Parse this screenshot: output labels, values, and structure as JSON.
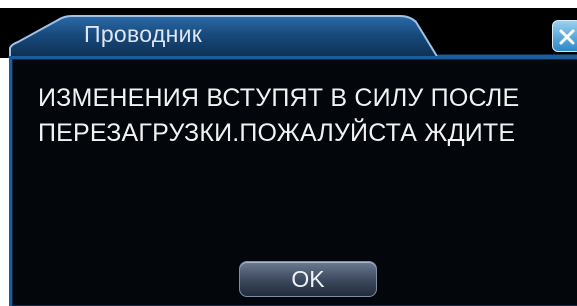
{
  "window": {
    "title": "Проводник",
    "close_icon": "close-icon"
  },
  "dialog": {
    "message": "ИЗМЕНЕНИЯ ВСТУПЯТ В СИЛУ ПОСЛЕ\nПЕРЕЗАГРУЗКИ.ПОЖАЛУЙСТА ЖДИТЕ",
    "ok_label": "OK"
  },
  "colors": {
    "background": "#000000",
    "frame": "#1b5d9c",
    "tab": "#17477a",
    "text": "#f2f2f2",
    "title_text": "#dfe6f2",
    "close_button": "#4aa3dd"
  }
}
